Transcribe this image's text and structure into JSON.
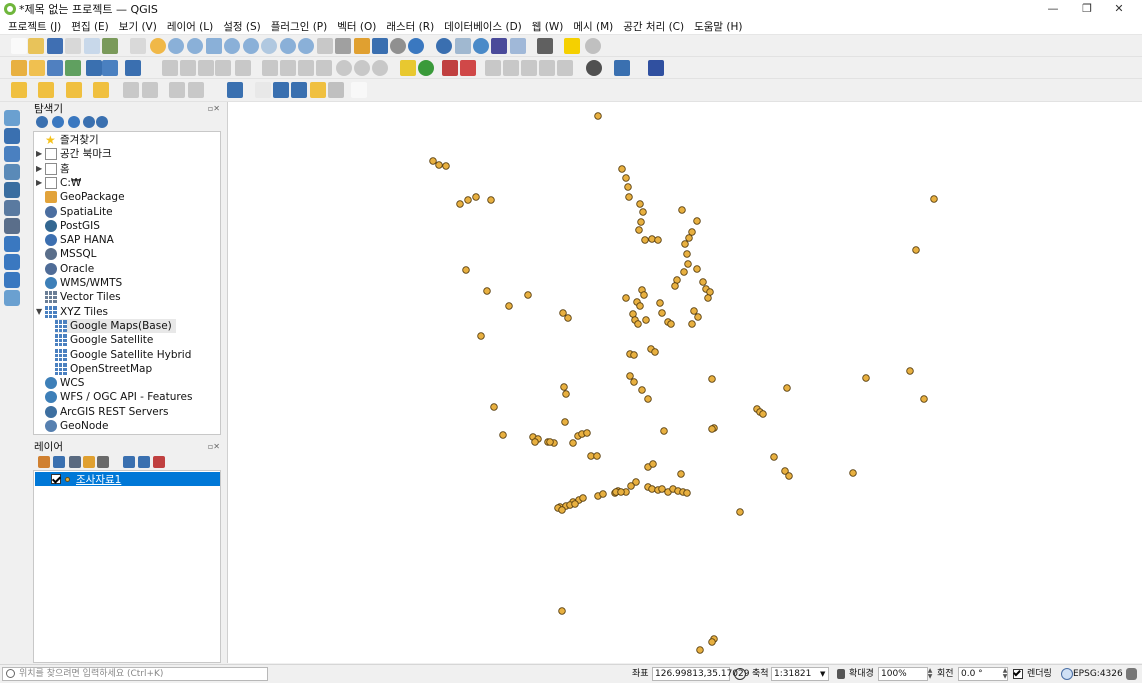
{
  "window": {
    "title": "*제목 없는 프로젝트 — QGIS",
    "minimize": "—",
    "maximize": "❐",
    "close": "✕"
  },
  "menu": [
    "프로젝트 (J)",
    "편집 (E)",
    "보기 (V)",
    "레이어 (L)",
    "설정 (S)",
    "플러그인 (P)",
    "벡터 (O)",
    "래스터 (R)",
    "데이터베이스 (D)",
    "웹 (W)",
    "메시 (M)",
    "공간 처리 (C)",
    "도움말 (H)"
  ],
  "browser": {
    "title": "탐색기",
    "close": "▫✕",
    "items": [
      {
        "label": "즐겨찾기",
        "icon": "star-icon",
        "level": 0,
        "arrow": ""
      },
      {
        "label": "공간 북마크",
        "icon": "bookmark-icon",
        "level": 0,
        "arrow": "▶"
      },
      {
        "label": "홈",
        "icon": "home-folder-icon",
        "level": 0,
        "arrow": "▶"
      },
      {
        "label": "C:₩",
        "icon": "folder-icon",
        "level": 0,
        "arrow": "▶"
      },
      {
        "label": "GeoPackage",
        "icon": "geopackage-icon",
        "level": 0,
        "arrow": ""
      },
      {
        "label": "SpatiaLite",
        "icon": "spatialite-icon",
        "level": 0,
        "arrow": ""
      },
      {
        "label": "PostGIS",
        "icon": "postgis-icon",
        "level": 0,
        "arrow": ""
      },
      {
        "label": "SAP HANA",
        "icon": "sap-hana-icon",
        "level": 0,
        "arrow": ""
      },
      {
        "label": "MSSQL",
        "icon": "mssql-icon",
        "level": 0,
        "arrow": ""
      },
      {
        "label": "Oracle",
        "icon": "oracle-icon",
        "level": 0,
        "arrow": ""
      },
      {
        "label": "WMS/WMTS",
        "icon": "wms-icon",
        "level": 0,
        "arrow": ""
      },
      {
        "label": "Vector Tiles",
        "icon": "vector-tiles-icon",
        "level": 0,
        "arrow": ""
      },
      {
        "label": "XYZ Tiles",
        "icon": "xyz-tiles-icon",
        "level": 0,
        "arrow": "▼"
      },
      {
        "label": "Google Maps(Base)",
        "icon": "tile-grid-icon",
        "level": 1,
        "arrow": "",
        "selected": true
      },
      {
        "label": "Google Satellite",
        "icon": "tile-grid-icon",
        "level": 1,
        "arrow": ""
      },
      {
        "label": "Google Satellite Hybrid",
        "icon": "tile-grid-icon",
        "level": 1,
        "arrow": ""
      },
      {
        "label": "OpenStreetMap",
        "icon": "tile-grid-icon",
        "level": 1,
        "arrow": ""
      },
      {
        "label": "WCS",
        "icon": "wcs-icon",
        "level": 0,
        "arrow": ""
      },
      {
        "label": "WFS / OGC API - Features",
        "icon": "wfs-icon",
        "level": 0,
        "arrow": ""
      },
      {
        "label": "ArcGIS REST Servers",
        "icon": "arcgis-icon",
        "level": 0,
        "arrow": ""
      },
      {
        "label": "GeoNode",
        "icon": "geonode-icon",
        "level": 0,
        "arrow": ""
      }
    ]
  },
  "layers": {
    "title": "레이어",
    "close": "▫✕",
    "items": [
      {
        "name": "조사자료1",
        "checked": true
      }
    ]
  },
  "map": {
    "point_fill": "#e8b040",
    "point_stroke": "#5a4010"
  },
  "status": {
    "locator_placeholder": "위치를 찾으려면 입력하세요 (Ctrl+K)",
    "coord_label": "좌표",
    "coord_value": "126.99813,35.17029",
    "scale_label": "축척",
    "scale_value": "1:31821",
    "magnifier_label": "확대경",
    "magnifier_value": "100%",
    "rotation_label": "회전",
    "rotation_value": "0.0 °",
    "render_label": "렌더링",
    "crs": "EPSG:4326"
  },
  "colors": {
    "selection": "#0078d7",
    "panel": "#f0f0f0"
  }
}
